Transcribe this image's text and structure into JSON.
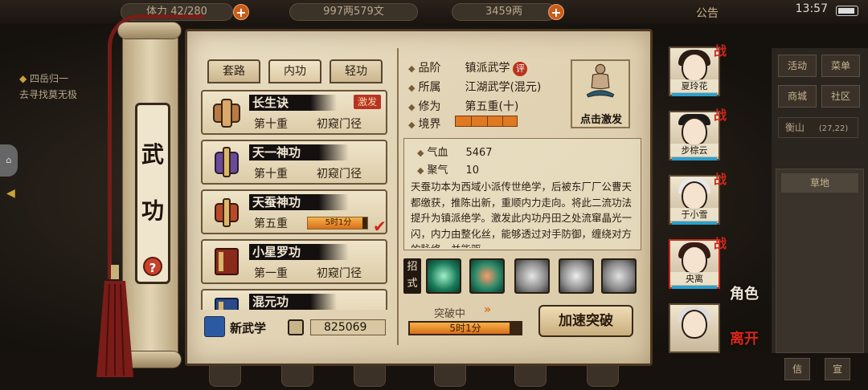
{
  "topbar": {
    "stamina": "42/280",
    "stamina_prefix": "体力",
    "money": "997两579文",
    "gold": "3459两",
    "notice": "公告",
    "time": "13:57"
  },
  "quest": {
    "title": "四岳归一",
    "desc": "去寻找莫无极"
  },
  "right_menu": {
    "buttons": [
      "活动",
      "菜单",
      "商城",
      "社区"
    ],
    "location": "衡山",
    "coords": "(27,22)",
    "terrain": "草地",
    "bottom_buttons": [
      "信",
      "宣"
    ]
  },
  "scroll": {
    "title_chars": [
      "武",
      "功"
    ],
    "help": "?"
  },
  "tabs": [
    {
      "label": "套路",
      "active": false
    },
    {
      "label": "内功",
      "active": true
    },
    {
      "label": "轻功",
      "active": false
    }
  ],
  "skills": [
    {
      "name": "长生诀",
      "level": "第十重",
      "stage": "初窥门径",
      "badge": "激发"
    },
    {
      "name": "天一神功",
      "level": "第十重",
      "stage": "初窥门径"
    },
    {
      "name": "天蚕神功",
      "level": "第五重",
      "timer": "5时1分",
      "timer_fraction": 0.92
    },
    {
      "name": "小星罗功",
      "level": "第一重",
      "stage": "初窥门径"
    },
    {
      "name": "混元功",
      "level": "",
      "stage": ""
    }
  ],
  "footer": {
    "new_label": "新武学",
    "points": "825069"
  },
  "detail": {
    "grade_label": "品阶",
    "grade": "镇派武学",
    "grade_badge": "评",
    "belong_label": "所属",
    "belong": "江湖武学(混元)",
    "cultivation_label": "修为",
    "cultivation": "第五重(十)",
    "realm_label": "境界",
    "activate_label": "点击激发",
    "qixue_label": "气血",
    "qixue": "5467",
    "juqi_label": "聚气",
    "juqi": "10",
    "description": "天蚕功本为西域小派传世绝学，后被东厂厂公曹天都缴获，推陈出新，重顺内力走向。将此二流功法提升为镇派绝学。激发此内功丹田之处流窜晶光一闪，内力由整化丝，能够透过对手防御，缠绕对方的脉络，并能驱",
    "moves_label": "招式",
    "progress_label": "突破中",
    "progress_text": "5时1分",
    "progress_fraction": 0.9,
    "speed_button": "加速突破"
  },
  "characters": [
    {
      "name": "夏玲花",
      "tag": "战"
    },
    {
      "name": "步棕云",
      "tag": "战"
    },
    {
      "name": "于小雪",
      "tag": "战"
    },
    {
      "name": "央离",
      "tag": "战"
    },
    {
      "name": "",
      "tag": ""
    }
  ],
  "side_actions": {
    "role": "角色",
    "leave": "离开"
  },
  "colors": {
    "accent_red": "#c8281a",
    "progress_orange": "#e07a22",
    "parchment": "#e9ddc2"
  }
}
